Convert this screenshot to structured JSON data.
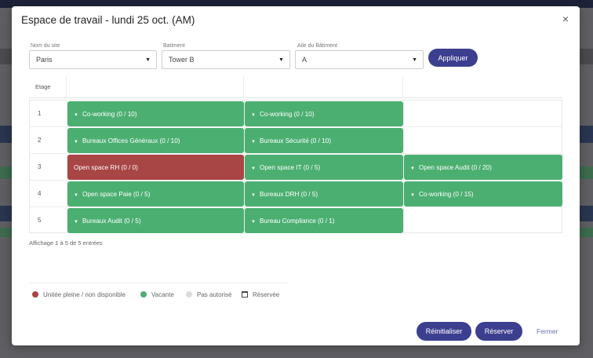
{
  "modal": {
    "title": "Espace de travail - lundi 25 oct. (AM)",
    "close_glyph": "×"
  },
  "filters": {
    "site": {
      "label": "Nom du site",
      "value": "Paris"
    },
    "batiment": {
      "label": "Batiment",
      "value": "Tower B"
    },
    "aile": {
      "label": "Aile du Bâtiment",
      "value": "A"
    },
    "apply_label": "Appliquer"
  },
  "grid": {
    "header_etage": "Etage",
    "rows": [
      {
        "etage": "1",
        "cells": [
          {
            "label": "Co-working (0 / 10)",
            "status": "vacante"
          },
          {
            "label": "Co-working (0 / 10)",
            "status": "vacante"
          }
        ]
      },
      {
        "etage": "2",
        "cells": [
          {
            "label": "Bureaux Offices Généraux (0 / 10)",
            "status": "vacante"
          },
          {
            "label": "Bureaux Sécurité (0 / 10)",
            "status": "vacante"
          }
        ]
      },
      {
        "etage": "3",
        "cells": [
          {
            "label": "Open space RH (0 / 0)",
            "status": "pleine"
          },
          {
            "label": "Open space IT (0 / 5)",
            "status": "vacante"
          },
          {
            "label": "Open space Audit (0 / 20)",
            "status": "vacante"
          }
        ]
      },
      {
        "etage": "4",
        "cells": [
          {
            "label": "Open space Paie (0 / 5)",
            "status": "vacante"
          },
          {
            "label": "Bureaux DRH (0 / 5)",
            "status": "vacante"
          },
          {
            "label": "Co-working (0 / 15)",
            "status": "vacante"
          }
        ]
      },
      {
        "etage": "5",
        "cells": [
          {
            "label": "Bureaux Audit (0 / 5)",
            "status": "vacante"
          },
          {
            "label": "Bureau Compliance (0 / 1)",
            "status": "vacante"
          }
        ]
      }
    ]
  },
  "entries_info": "Affichage 1 à 5 de 5 entrées",
  "legend": {
    "pleine": "Unitée pleine / non disponible",
    "vacante": "Vacante",
    "non_autorise": "Pas autorisé",
    "reservee": "Réservée"
  },
  "footer": {
    "reset_label": "Réinitialiser",
    "reserve_label": "Réserver",
    "close_label": "Fermer"
  },
  "colors": {
    "vacante": "#4caf72",
    "pleine": "#a84545",
    "non_autorise": "#dcdcdc",
    "accent": "#3c3f8f"
  }
}
